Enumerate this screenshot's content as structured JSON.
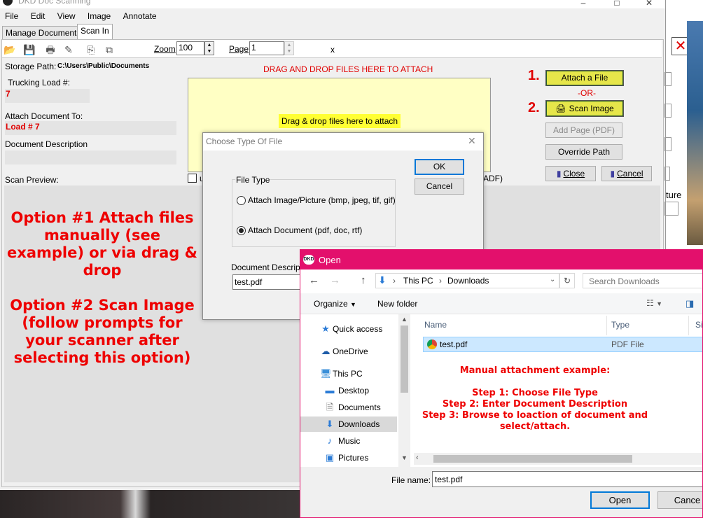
{
  "app": {
    "title": "DKD Doc Scanning",
    "menu": [
      "File",
      "Edit",
      "View",
      "Image",
      "Annotate"
    ],
    "tabs": [
      "Manage Documents",
      "Scan In"
    ],
    "toolbar": {
      "zoom_label": "Zoom",
      "zoom_value": "100",
      "page_label": "Page",
      "page_value": "1",
      "x_label": "x"
    },
    "storage_path_label": "Storage Path:",
    "storage_path_value": "C:\\Users\\Public\\Documents",
    "trucking_load_label": "Trucking Load #:",
    "trucking_load_value": "7",
    "attach_to_label": "Attach Document To:",
    "attach_to_value": "Load # 7",
    "doc_desc_label": "Document Description",
    "scan_preview_label": "Scan Preview:",
    "drag_header": "DRAG AND DROP FILES HERE TO ATTACH",
    "drag_hint": "Drag & drop files here to attach",
    "adf_fragment": "ADF)",
    "checkbox_fragment": "u",
    "buttons": {
      "attach_file": "Attach a File",
      "or": "-OR-",
      "scan_image": "Scan Image",
      "add_page": "Add Page (PDF)",
      "override_path": "Override Path",
      "close": "Close",
      "cancel": "Cancel"
    },
    "step_numbers": [
      "1.",
      "2."
    ],
    "right_fragment": "ture"
  },
  "annotation": {
    "option1": "Option #1 Attach files manually (see example) or via drag & drop",
    "option2": "Option #2 Scan Image (follow prompts for your scanner after selecting this option)",
    "manual_title": "Manual attachment example:",
    "step1": "Step 1: Choose File Type",
    "step2": "Step 2: Enter Document Description",
    "step3": "Step 3: Browse to loaction of document and select/attach."
  },
  "choose_dialog": {
    "title": "Choose Type Of File",
    "group_label": "File Type",
    "option_image": "Attach Image/Picture (bmp, jpeg, tif, gif)",
    "option_document": "Attach Document (pdf, doc, rtf)",
    "selected": "document",
    "ok": "OK",
    "cancel": "Cancel",
    "desc_label": "Document Description",
    "desc_value": "test.pdf"
  },
  "open_dialog": {
    "title": "Open",
    "breadcrumb": [
      "This PC",
      "Downloads"
    ],
    "search_placeholder": "Search Downloads",
    "organize": "Organize",
    "new_folder": "New folder",
    "nav": [
      "Quick access",
      "OneDrive",
      "This PC",
      "Desktop",
      "Documents",
      "Downloads",
      "Music",
      "Pictures"
    ],
    "columns": [
      "Name",
      "Type",
      "Si"
    ],
    "files": [
      {
        "name": "test.pdf",
        "type": "PDF File"
      }
    ],
    "filename_label": "File name:",
    "filename_value": "test.pdf",
    "open": "Open",
    "cancel": "Cance"
  },
  "colors": {
    "accent_red": "#ee0000",
    "yellow_button": "#e6e64a",
    "drop_zone": "#ffffc4",
    "open_title_bar": "#e3106c"
  }
}
